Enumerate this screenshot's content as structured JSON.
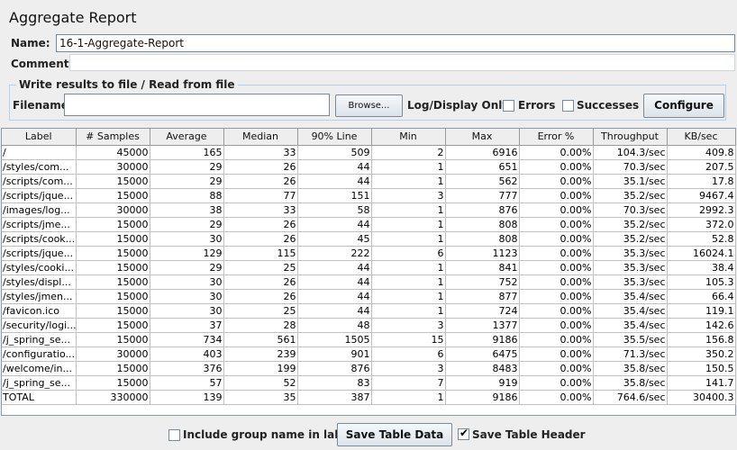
{
  "title": "Aggregate Report",
  "name_field": {
    "label": "Name:",
    "value": "16-1-Aggregate-Report"
  },
  "comments_field": {
    "label": "Comments:"
  },
  "file_section": {
    "legend": "Write results to file / Read from file",
    "filename_label": "Filename",
    "browse_label": "Browse...",
    "log_display_label": "Log/Display Only:",
    "errors_label": "Errors",
    "successes_label": "Successes",
    "configure_label": "Configure"
  },
  "table": {
    "columns": [
      "Label",
      "# Samples",
      "Average",
      "Median",
      "90% Line",
      "Min",
      "Max",
      "Error %",
      "Throughput",
      "KB/sec"
    ],
    "rows": [
      [
        "/",
        "45000",
        "165",
        "33",
        "509",
        "2",
        "6916",
        "0.00%",
        "104.3/sec",
        "409.8"
      ],
      [
        "/styles/com...",
        "30000",
        "29",
        "26",
        "44",
        "1",
        "651",
        "0.00%",
        "70.3/sec",
        "207.5"
      ],
      [
        "/scripts/com...",
        "15000",
        "29",
        "26",
        "44",
        "1",
        "562",
        "0.00%",
        "35.1/sec",
        "17.8"
      ],
      [
        "/scripts/jque...",
        "15000",
        "88",
        "77",
        "151",
        "3",
        "777",
        "0.00%",
        "35.2/sec",
        "9467.4"
      ],
      [
        "/images/log...",
        "30000",
        "38",
        "33",
        "58",
        "1",
        "876",
        "0.00%",
        "70.3/sec",
        "2992.3"
      ],
      [
        "/scripts/jme...",
        "15000",
        "29",
        "26",
        "44",
        "1",
        "808",
        "0.00%",
        "35.2/sec",
        "372.0"
      ],
      [
        "/scripts/cook...",
        "15000",
        "30",
        "26",
        "45",
        "1",
        "808",
        "0.00%",
        "35.2/sec",
        "52.8"
      ],
      [
        "/scripts/jque...",
        "15000",
        "129",
        "115",
        "222",
        "6",
        "1123",
        "0.00%",
        "35.3/sec",
        "16024.1"
      ],
      [
        "/styles/cooki...",
        "15000",
        "29",
        "25",
        "44",
        "1",
        "841",
        "0.00%",
        "35.3/sec",
        "38.4"
      ],
      [
        "/styles/displ...",
        "15000",
        "30",
        "26",
        "44",
        "1",
        "752",
        "0.00%",
        "35.3/sec",
        "105.3"
      ],
      [
        "/styles/jmen...",
        "15000",
        "30",
        "26",
        "44",
        "1",
        "877",
        "0.00%",
        "35.4/sec",
        "66.4"
      ],
      [
        "/favicon.ico",
        "15000",
        "30",
        "25",
        "44",
        "1",
        "724",
        "0.00%",
        "35.4/sec",
        "119.1"
      ],
      [
        "/security/logi...",
        "15000",
        "37",
        "28",
        "48",
        "3",
        "1377",
        "0.00%",
        "35.4/sec",
        "142.6"
      ],
      [
        "/j_spring_se...",
        "15000",
        "734",
        "561",
        "1505",
        "15",
        "9186",
        "0.00%",
        "35.5/sec",
        "156.8"
      ],
      [
        "/configuratio...",
        "30000",
        "403",
        "239",
        "901",
        "6",
        "6475",
        "0.00%",
        "71.3/sec",
        "350.2"
      ],
      [
        "/welcome/in...",
        "15000",
        "376",
        "199",
        "876",
        "3",
        "8483",
        "0.00%",
        "35.8/sec",
        "150.5"
      ],
      [
        "/j_spring_se...",
        "15000",
        "57",
        "52",
        "83",
        "7",
        "919",
        "0.00%",
        "35.8/sec",
        "141.7"
      ],
      [
        "TOTAL",
        "330000",
        "139",
        "35",
        "387",
        "1",
        "9186",
        "0.00%",
        "764.6/sec",
        "30400.3"
      ]
    ]
  },
  "footer": {
    "include_group_label": "Include group name in label?",
    "include_group_checked": false,
    "save_table_data_label": "Save Table Data",
    "save_table_header_label": "Save Table Header",
    "save_table_header_checked": true
  }
}
